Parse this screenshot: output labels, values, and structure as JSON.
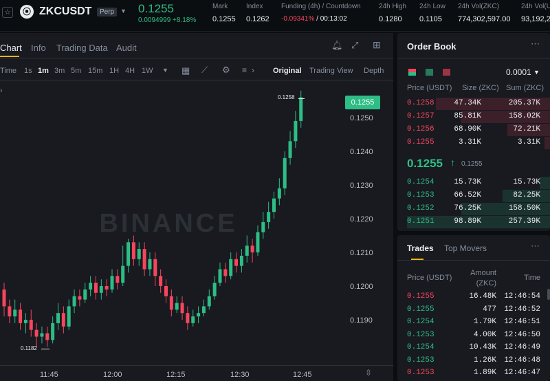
{
  "header": {
    "symbol": "ZKCUSDT",
    "contract_type": "Perp",
    "last_price": "0.1255",
    "change": "0.0094999 +8.18%",
    "stats": [
      {
        "label": "Mark",
        "value": "0.1255"
      },
      {
        "label": "Index",
        "value": "0.1262"
      },
      {
        "label": "Funding (4h) / Countdown",
        "value_red": "-0.09341%",
        "value_rest": " / 00:13:02"
      },
      {
        "label": "24h High",
        "value": "0.1280"
      },
      {
        "label": "24h Low",
        "value": "0.1105"
      },
      {
        "label": "24h Vol(ZKC)",
        "value": "774,302,597.00"
      },
      {
        "label": "24h Vol(U",
        "value": "93,192,2"
      }
    ]
  },
  "chart_tabs": [
    "Chart",
    "Info",
    "Trading Data",
    "Audit"
  ],
  "timeframes": [
    "Time",
    "1s",
    "1m",
    "3m",
    "5m",
    "15m",
    "1H",
    "4H",
    "1W"
  ],
  "active_timeframe": "1m",
  "views": [
    "Original",
    "Trading View",
    "Depth"
  ],
  "active_view": "Original",
  "chart": {
    "watermark": "BINANCE",
    "current_price_label": "0.1255",
    "high_label": "0.1258",
    "low_label": "0.1182",
    "y_ticks": [
      "0.1250",
      "0.1240",
      "0.1230",
      "0.1220",
      "0.1210",
      "0.1200",
      "0.1190"
    ],
    "x_ticks": [
      "11:45",
      "12:00",
      "12:15",
      "12:30",
      "12:45"
    ]
  },
  "chart_data": {
    "type": "candlestick",
    "ylim": [
      0.118,
      0.126
    ],
    "x_ticks": [
      "11:45",
      "12:00",
      "12:15",
      "12:30",
      "12:45"
    ],
    "candles": [
      {
        "o": 0.1199,
        "c": 0.1194,
        "h": 0.1201,
        "l": 0.1191
      },
      {
        "o": 0.1194,
        "c": 0.1191,
        "h": 0.1196,
        "l": 0.1189
      },
      {
        "o": 0.1191,
        "c": 0.1193,
        "h": 0.1196,
        "l": 0.1189
      },
      {
        "o": 0.1193,
        "c": 0.1189,
        "h": 0.1195,
        "l": 0.1187
      },
      {
        "o": 0.1189,
        "c": 0.119,
        "h": 0.1192,
        "l": 0.1186
      },
      {
        "o": 0.119,
        "c": 0.1187,
        "h": 0.1193,
        "l": 0.1185
      },
      {
        "o": 0.1187,
        "c": 0.1185,
        "h": 0.1189,
        "l": 0.1182
      },
      {
        "o": 0.1185,
        "c": 0.1186,
        "h": 0.1188,
        "l": 0.1183
      },
      {
        "o": 0.1186,
        "c": 0.1184,
        "h": 0.1188,
        "l": 0.1182
      },
      {
        "o": 0.1184,
        "c": 0.1189,
        "h": 0.1191,
        "l": 0.1183
      },
      {
        "o": 0.1189,
        "c": 0.1192,
        "h": 0.1195,
        "l": 0.1187
      },
      {
        "o": 0.1192,
        "c": 0.1188,
        "h": 0.1194,
        "l": 0.1186
      },
      {
        "o": 0.1188,
        "c": 0.1194,
        "h": 0.1196,
        "l": 0.1187
      },
      {
        "o": 0.1194,
        "c": 0.1197,
        "h": 0.1199,
        "l": 0.1192
      },
      {
        "o": 0.1197,
        "c": 0.1196,
        "h": 0.1199,
        "l": 0.1194
      },
      {
        "o": 0.1196,
        "c": 0.1199,
        "h": 0.1201,
        "l": 0.1195
      },
      {
        "o": 0.1199,
        "c": 0.1201,
        "h": 0.1203,
        "l": 0.1197
      },
      {
        "o": 0.1201,
        "c": 0.1198,
        "h": 0.1203,
        "l": 0.1196
      },
      {
        "o": 0.1198,
        "c": 0.12,
        "h": 0.1202,
        "l": 0.1196
      },
      {
        "o": 0.12,
        "c": 0.1199,
        "h": 0.1202,
        "l": 0.1197
      },
      {
        "o": 0.1199,
        "c": 0.1203,
        "h": 0.1205,
        "l": 0.1198
      },
      {
        "o": 0.1203,
        "c": 0.1201,
        "h": 0.1205,
        "l": 0.1199
      },
      {
        "o": 0.1201,
        "c": 0.1206,
        "h": 0.1212,
        "l": 0.12
      },
      {
        "o": 0.1206,
        "c": 0.1213,
        "h": 0.1214,
        "l": 0.1204
      },
      {
        "o": 0.1213,
        "c": 0.1208,
        "h": 0.1215,
        "l": 0.1206
      },
      {
        "o": 0.1208,
        "c": 0.1211,
        "h": 0.1213,
        "l": 0.1206
      },
      {
        "o": 0.1211,
        "c": 0.1205,
        "h": 0.1213,
        "l": 0.1203
      },
      {
        "o": 0.1205,
        "c": 0.1208,
        "h": 0.121,
        "l": 0.1203
      },
      {
        "o": 0.1208,
        "c": 0.1203,
        "h": 0.121,
        "l": 0.12
      },
      {
        "o": 0.1203,
        "c": 0.12,
        "h": 0.1205,
        "l": 0.1198
      },
      {
        "o": 0.12,
        "c": 0.1197,
        "h": 0.1202,
        "l": 0.1195
      },
      {
        "o": 0.1197,
        "c": 0.1193,
        "h": 0.1199,
        "l": 0.1191
      },
      {
        "o": 0.1193,
        "c": 0.1195,
        "h": 0.1197,
        "l": 0.1192
      },
      {
        "o": 0.1195,
        "c": 0.1192,
        "h": 0.1197,
        "l": 0.119
      },
      {
        "o": 0.1192,
        "c": 0.1189,
        "h": 0.1194,
        "l": 0.1187
      },
      {
        "o": 0.1189,
        "c": 0.1191,
        "h": 0.1193,
        "l": 0.1188
      },
      {
        "o": 0.1191,
        "c": 0.1192,
        "h": 0.1194,
        "l": 0.1189
      },
      {
        "o": 0.1192,
        "c": 0.1194,
        "h": 0.1196,
        "l": 0.1191
      },
      {
        "o": 0.1194,
        "c": 0.1197,
        "h": 0.1199,
        "l": 0.1193
      },
      {
        "o": 0.1197,
        "c": 0.1201,
        "h": 0.1203,
        "l": 0.1196
      },
      {
        "o": 0.1201,
        "c": 0.1205,
        "h": 0.1207,
        "l": 0.12
      },
      {
        "o": 0.1205,
        "c": 0.1203,
        "h": 0.1207,
        "l": 0.1201
      },
      {
        "o": 0.1203,
        "c": 0.1208,
        "h": 0.121,
        "l": 0.1202
      },
      {
        "o": 0.1208,
        "c": 0.1206,
        "h": 0.121,
        "l": 0.1204
      },
      {
        "o": 0.1206,
        "c": 0.1209,
        "h": 0.1211,
        "l": 0.1204
      },
      {
        "o": 0.1209,
        "c": 0.1212,
        "h": 0.1215,
        "l": 0.1207
      },
      {
        "o": 0.1212,
        "c": 0.121,
        "h": 0.1214,
        "l": 0.1207
      },
      {
        "o": 0.121,
        "c": 0.1216,
        "h": 0.1218,
        "l": 0.1209
      },
      {
        "o": 0.1216,
        "c": 0.1219,
        "h": 0.1222,
        "l": 0.1214
      },
      {
        "o": 0.1219,
        "c": 0.1222,
        "h": 0.1225,
        "l": 0.1217
      },
      {
        "o": 0.1222,
        "c": 0.1226,
        "h": 0.1228,
        "l": 0.122
      },
      {
        "o": 0.1226,
        "c": 0.1229,
        "h": 0.1232,
        "l": 0.1224
      },
      {
        "o": 0.1229,
        "c": 0.1238,
        "h": 0.124,
        "l": 0.1227
      },
      {
        "o": 0.1238,
        "c": 0.1243,
        "h": 0.1246,
        "l": 0.1236
      },
      {
        "o": 0.1243,
        "c": 0.1249,
        "h": 0.1252,
        "l": 0.1241
      },
      {
        "o": 0.1249,
        "c": 0.1256,
        "h": 0.1258,
        "l": 0.1247
      }
    ]
  },
  "order_book": {
    "title": "Order Book",
    "precision": "0.0001",
    "headers": [
      "Price (USDT)",
      "Size (ZKC)",
      "Sum (ZKC)"
    ],
    "asks": [
      {
        "price": "0.1258",
        "size": "47.34K",
        "sum": "205.37K",
        "depth": 0.8
      },
      {
        "price": "0.1257",
        "size": "85.81K",
        "sum": "158.02K",
        "depth": 0.62
      },
      {
        "price": "0.1256",
        "size": "68.90K",
        "sum": "72.21K",
        "depth": 0.3
      },
      {
        "price": "0.1255",
        "size": "3.31K",
        "sum": "3.31K",
        "depth": 0.04
      }
    ],
    "mid_price": "0.1255",
    "mid_mark": "0.1255",
    "bids": [
      {
        "price": "0.1254",
        "size": "15.73K",
        "sum": "15.73K",
        "depth": 0.07
      },
      {
        "price": "0.1253",
        "size": "66.52K",
        "sum": "82.25K",
        "depth": 0.33
      },
      {
        "price": "0.1252",
        "size": "76.25K",
        "sum": "158.50K",
        "depth": 0.62
      },
      {
        "price": "0.1251",
        "size": "98.89K",
        "sum": "257.39K",
        "depth": 1.0
      }
    ]
  },
  "trades": {
    "tabs": [
      "Trades",
      "Top Movers"
    ],
    "headers": [
      "Price (USDT)",
      "Amount (ZKC)",
      "Time"
    ],
    "rows": [
      {
        "price": "0.1255",
        "amount": "16.48K",
        "time": "12:46:54",
        "side": "sell"
      },
      {
        "price": "0.1255",
        "amount": "477",
        "time": "12:46:52",
        "side": "buy"
      },
      {
        "price": "0.1254",
        "amount": "1.79K",
        "time": "12:46:51",
        "side": "buy"
      },
      {
        "price": "0.1253",
        "amount": "4.00K",
        "time": "12:46:50",
        "side": "buy"
      },
      {
        "price": "0.1254",
        "amount": "10.43K",
        "time": "12:46:49",
        "side": "buy"
      },
      {
        "price": "0.1253",
        "amount": "1.26K",
        "time": "12:46:48",
        "side": "buy"
      },
      {
        "price": "0.1253",
        "amount": "1.89K",
        "time": "12:46:47",
        "side": "sell"
      }
    ]
  },
  "colors": {
    "up": "#2ebd85",
    "down": "#f6465d",
    "bg": "#181a20",
    "accent": "#f0b90b"
  }
}
